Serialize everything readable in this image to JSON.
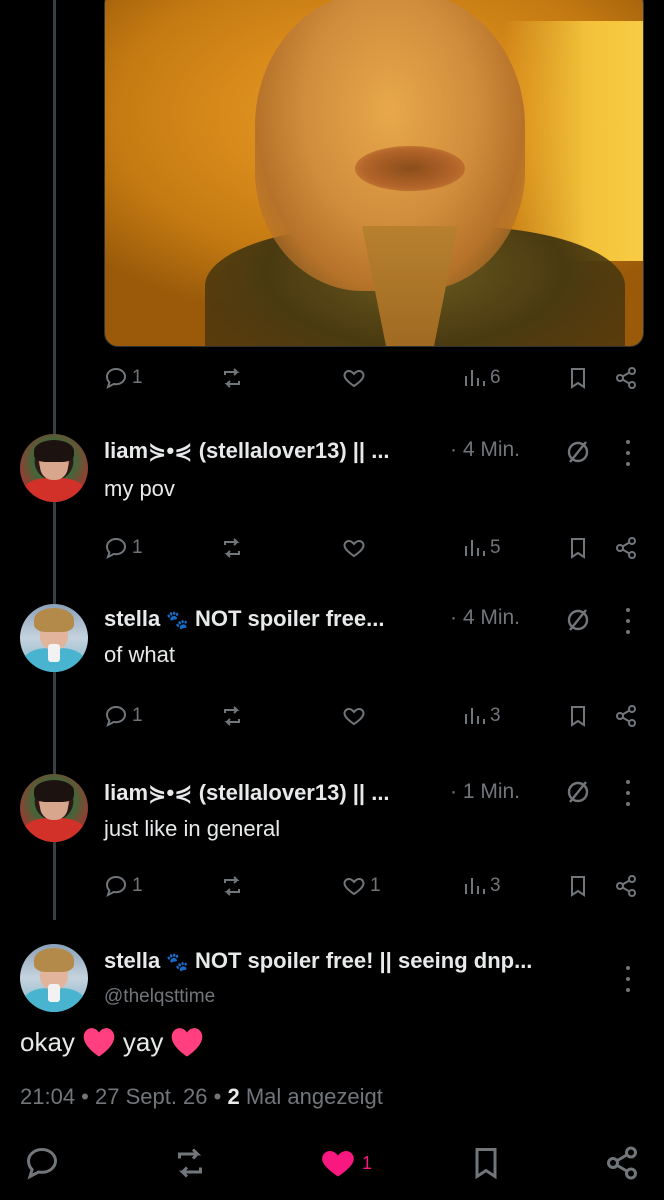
{
  "thread": {
    "first_post_stats": {
      "replies": "1",
      "views": "6"
    },
    "replies": [
      {
        "author": "liam⋟•⋞ (stellalover13) || ...",
        "time": "· 4 Min.",
        "text": "my pov",
        "replies": "1",
        "likes": "",
        "views": "5"
      },
      {
        "author_prefix": "stella",
        "author_suffix": "NOT spoiler free...",
        "time": "· 4 Min.",
        "text": "of what",
        "replies": "1",
        "likes": "",
        "views": "3"
      },
      {
        "author": "liam⋟•⋞ (stellalover13) || ...",
        "time": "· 1 Min.",
        "text": "just like in general",
        "replies": "1",
        "likes": "1",
        "views": "3"
      }
    ]
  },
  "focused_post": {
    "author_prefix": "stella",
    "author_suffix": "NOT spoiler free! || seeing dnp...",
    "handle": "@thelqsttime",
    "text_1": "okay",
    "text_2": "yay",
    "timestamp": "21:04 • 27 Sept. 26 •",
    "view_count": "2",
    "view_label": "Mal angezeigt",
    "like_count": "1"
  },
  "colors": {
    "like_pink": "#f91880",
    "muted": "#71767b",
    "text": "#e7e9ea"
  }
}
